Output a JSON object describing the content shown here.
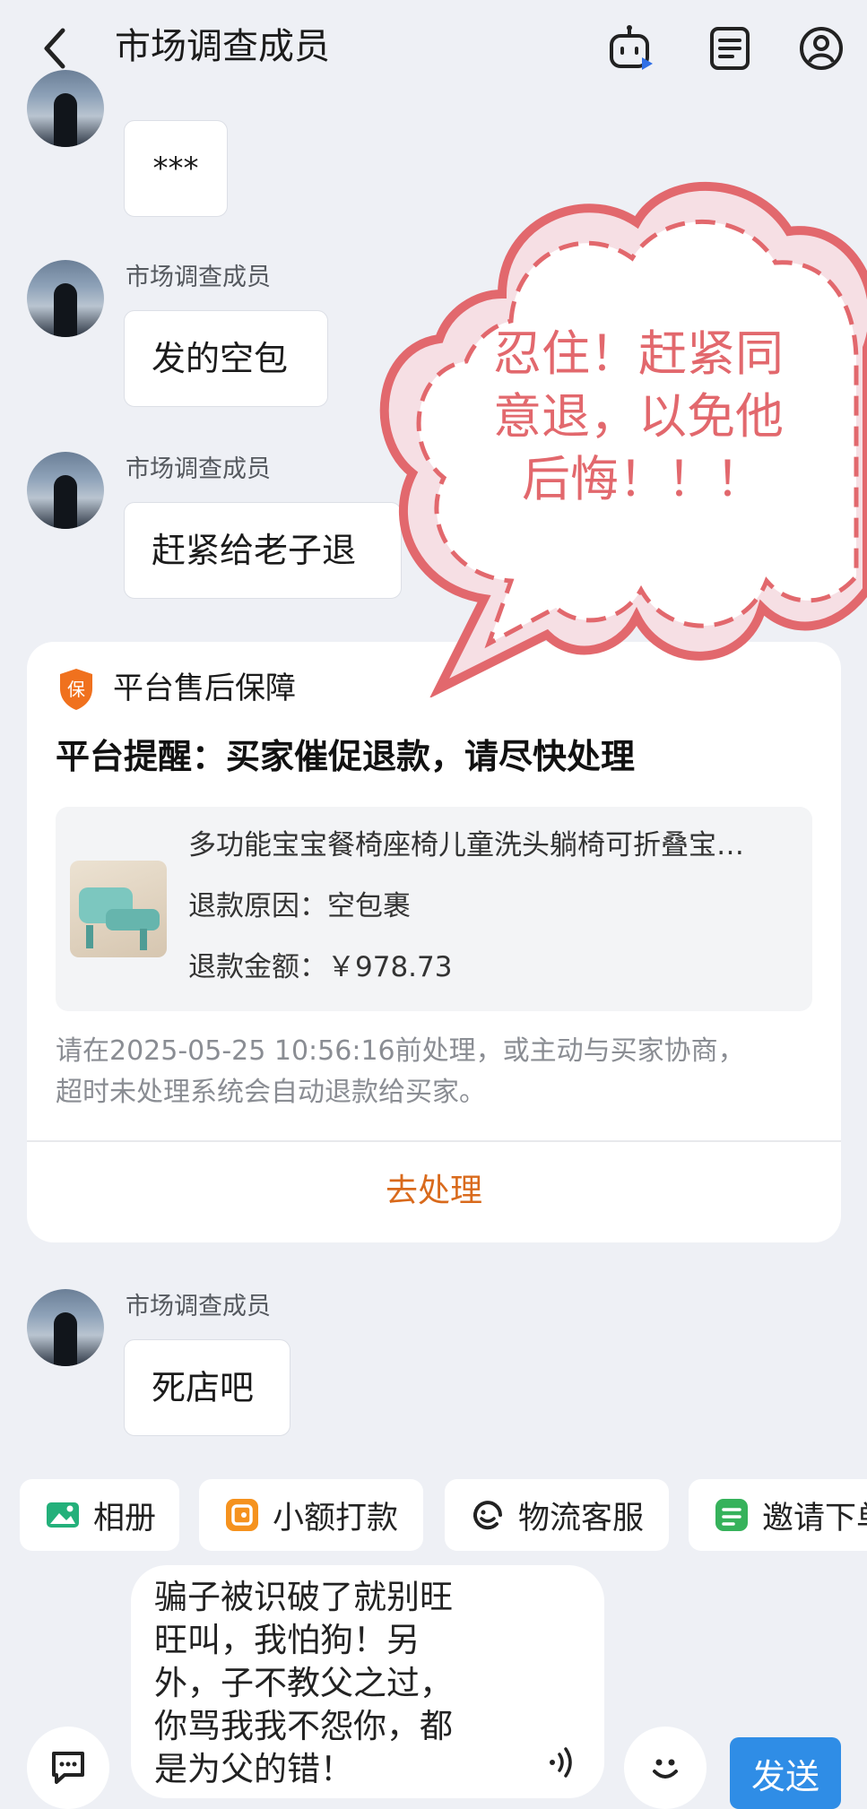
{
  "header": {
    "title": "市场调查成员"
  },
  "messages": [
    {
      "text": "***"
    },
    {
      "sender": "市场调查成员",
      "text": "发的空包"
    },
    {
      "sender": "市场调查成员",
      "text": "赶紧给老子退"
    }
  ],
  "card": {
    "tag": "平台售后保障",
    "badge": "保",
    "title": "平台提醒：买家催促退款，请尽快处理",
    "product_name": "多功能宝宝餐椅座椅儿童洗头躺椅可折叠宝…",
    "reason": "退款原因：空包裹",
    "amount": "退款金额：￥978.73",
    "notice_line1": "请在2025-05-25 10:56:16前处理，或主动与买家协商，",
    "notice_line2": "超时未处理系统会自动退款给买家。",
    "action": "去处理"
  },
  "last_message": {
    "sender": "市场调查成员",
    "text": "死店吧"
  },
  "quick_actions": [
    {
      "label": "相册"
    },
    {
      "label": "小额打款"
    },
    {
      "label": "物流客服"
    },
    {
      "label": "邀请下单"
    }
  ],
  "input": {
    "text": "骗子被识破了就别旺\n旺叫，我怕狗！另\n外，子不教父之过，\n你骂我我不怨你，都\n是为父的错！"
  },
  "send_label": "发送",
  "overlay": {
    "line1": "忍住！赶紧同",
    "line2": "意退，以免他",
    "line3": "后悔！！！"
  },
  "colors": {
    "accent": "#d96a1c",
    "send": "#2f8de6",
    "cloud": "#e2686d"
  }
}
